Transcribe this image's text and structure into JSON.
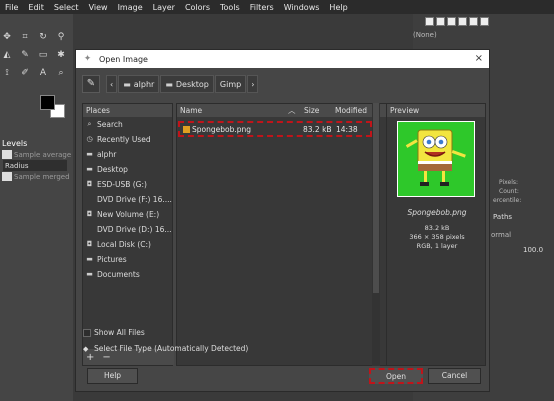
{
  "menubar": {
    "items": [
      "File",
      "Edit",
      "Select",
      "View",
      "Image",
      "Layer",
      "Colors",
      "Tools",
      "Filters",
      "Windows",
      "Help"
    ]
  },
  "tool_options": {
    "title": "Levels",
    "sample_average": "Sample average",
    "radius": "Radius",
    "sample_merged": "Sample merged"
  },
  "right_dock": {
    "none_label": "(None)",
    "pixels": "Pixels:",
    "count": "Count:",
    "percentile": "ercentile:",
    "paths_tab": "Paths",
    "mode": "ormal",
    "opacity": "100.0"
  },
  "dialog": {
    "title": "Open Image",
    "breadcrumbs": [
      "alphr",
      "Desktop",
      "Gimp"
    ],
    "places_header": "Places",
    "places": [
      {
        "icon": "search-icon",
        "label": "Search"
      },
      {
        "icon": "clock-icon",
        "label": "Recently Used"
      },
      {
        "icon": "folder-icon",
        "label": "alphr"
      },
      {
        "icon": "folder-icon",
        "label": "Desktop"
      },
      {
        "icon": "drive-icon",
        "label": "ESD-USB (G:)"
      },
      {
        "icon": "",
        "label": "DVD Drive (F:) 16...."
      },
      {
        "icon": "drive-icon",
        "label": "New Volume (E:)"
      },
      {
        "icon": "",
        "label": "DVD Drive (D:) 16...."
      },
      {
        "icon": "drive-icon",
        "label": "Local Disk (C:)"
      },
      {
        "icon": "folder-icon",
        "label": "Pictures"
      },
      {
        "icon": "folder-icon",
        "label": "Documents"
      }
    ],
    "add_label": "+",
    "remove_label": "−",
    "columns": {
      "name": "Name",
      "size": "Size",
      "modified": "Modified"
    },
    "files": [
      {
        "name": "Spongebob.png",
        "size": "83.2 kB",
        "modified": "14:38"
      }
    ],
    "preview": {
      "header": "Preview",
      "filename": "Spongebob.png",
      "filesize": "83.2 kB",
      "dimensions": "366 × 358 pixels",
      "mode": "RGB, 1 layer"
    },
    "show_all_files": "Show All Files",
    "file_type": "Select File Type (Automatically Detected)",
    "help": "Help",
    "open": "Open",
    "cancel": "Cancel"
  }
}
